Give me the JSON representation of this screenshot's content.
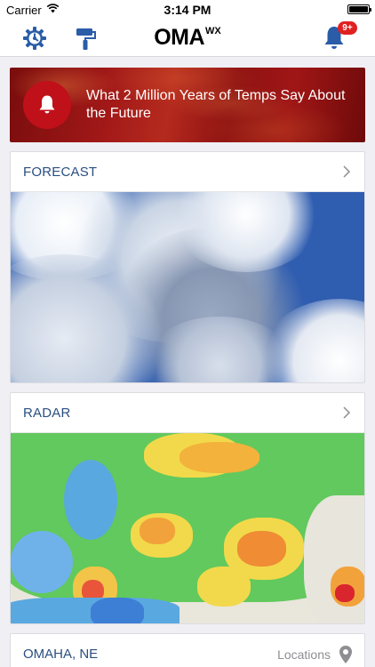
{
  "status_bar": {
    "carrier": "Carrier",
    "time": "3:14 PM"
  },
  "navbar": {
    "logo_main": "OMA",
    "logo_sup": "WX",
    "notification_badge": "9+",
    "icons": [
      "gear-icon",
      "paint-roller-icon",
      "bell-icon"
    ],
    "accent_color": "#2a5ca8"
  },
  "banner": {
    "text": "What 2 Million Years of Temps Say About the Future",
    "icon": "bell-icon",
    "color": "#a11818"
  },
  "cards": {
    "forecast": {
      "title": "FORECAST"
    },
    "radar": {
      "title": "RADAR"
    }
  },
  "location": {
    "name": "OMAHA, NE",
    "locations_label": "Locations",
    "icon": "map-pin-icon"
  },
  "colors": {
    "title_blue": "#2a4f80",
    "badge_red": "#e02121"
  }
}
